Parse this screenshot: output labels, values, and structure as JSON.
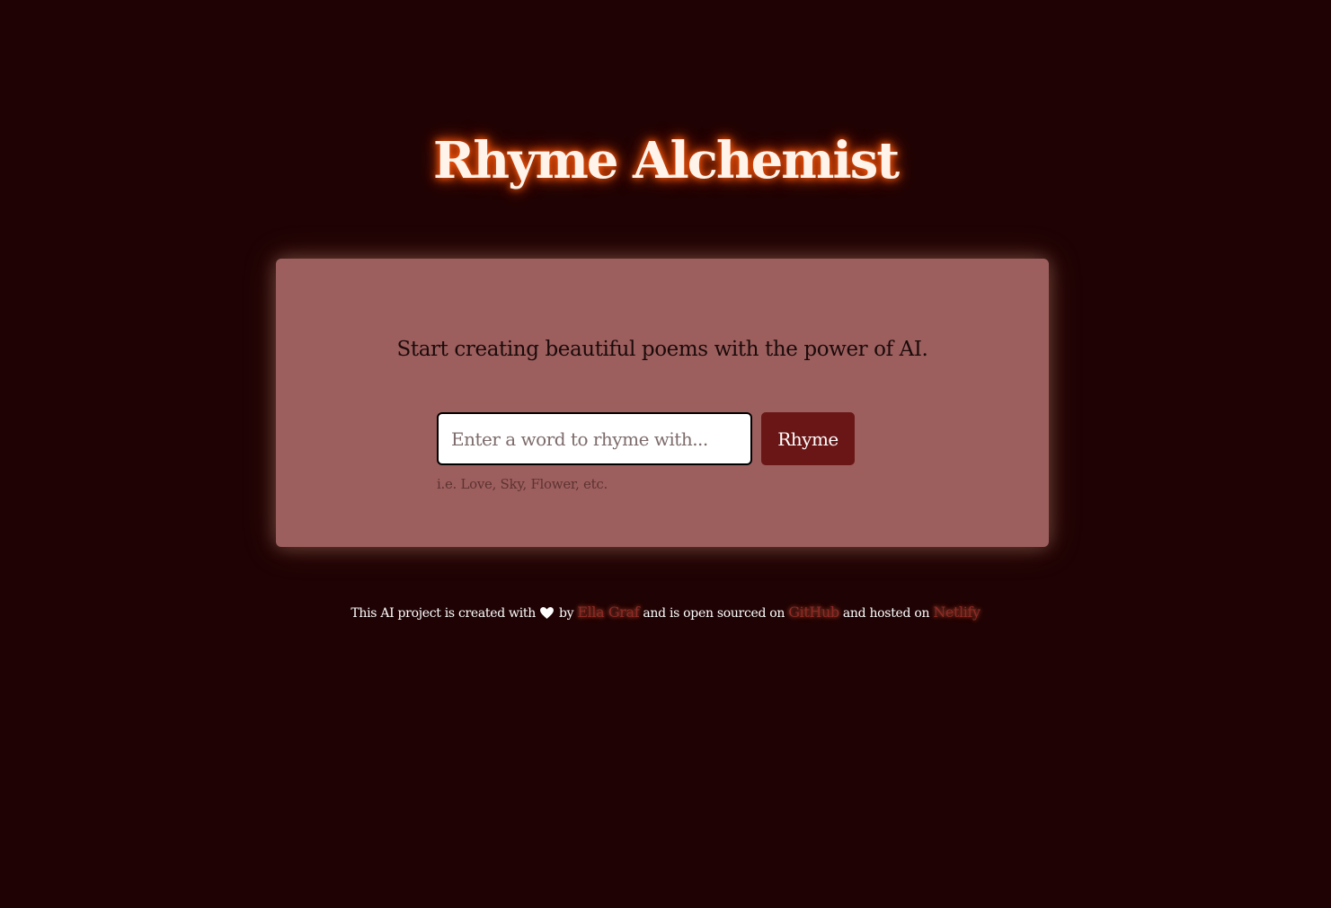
{
  "header": {
    "title": "Rhyme Alchemist"
  },
  "card": {
    "tagline": "Start creating beautiful poems with the power of AI.",
    "input": {
      "placeholder": "Enter a word to rhyme with...",
      "value": ""
    },
    "button_label": "Rhyme",
    "hint": "i.e. Love, Sky, Flower, etc."
  },
  "footer": {
    "text_before_heart": "This AI project is created with",
    "heart_icon": "heart-icon",
    "text_by": "by",
    "author_link": "Ella Graf",
    "text_open_sourced": "and is open sourced on",
    "github_link": "GitHub",
    "text_hosted": "and hosted on",
    "netlify_link": "Netlify"
  },
  "colors": {
    "background": "#1f0304",
    "card": "#9c5f5e",
    "button": "#6b1616",
    "title_glow": "#ff5b10",
    "link": "#8f2a26"
  }
}
